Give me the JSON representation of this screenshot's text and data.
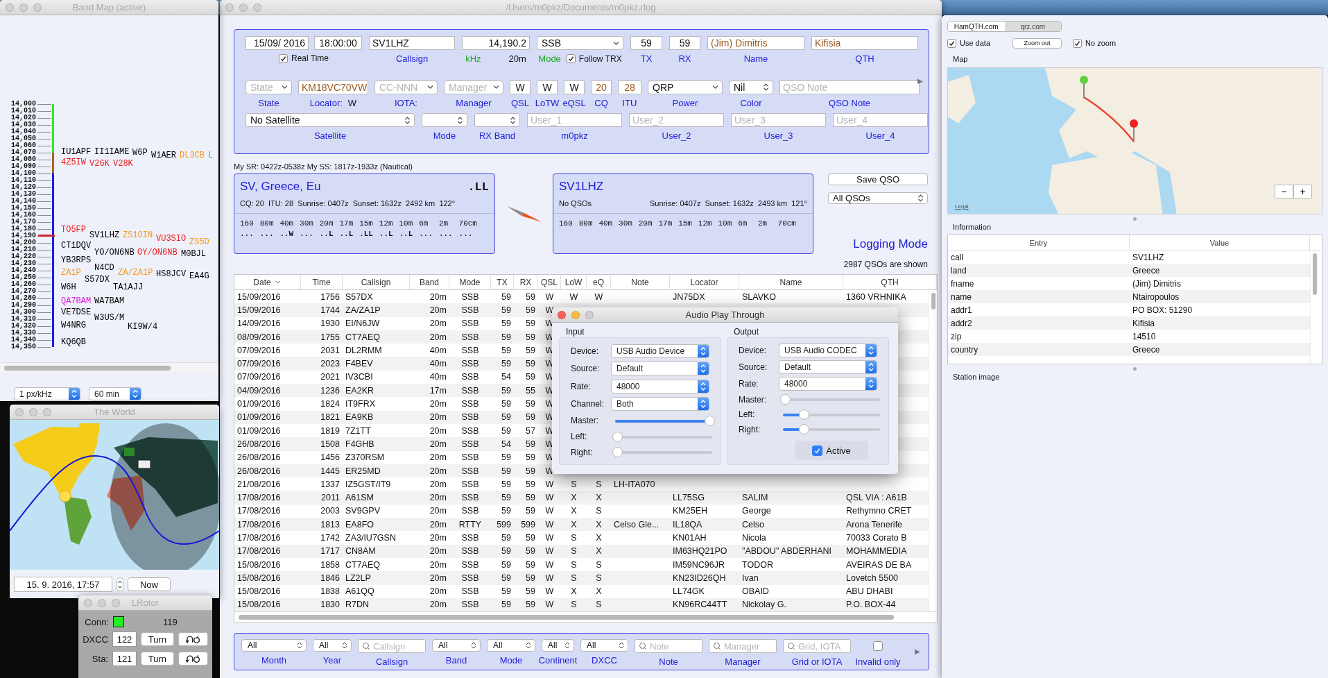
{
  "band_map": {
    "title": "Band Map (active)",
    "scale": [
      "14,000",
      "14,010",
      "14,020",
      "14,030",
      "14,040",
      "14,050",
      "14,060",
      "14,070",
      "14,080",
      "14,090",
      "14,100",
      "14,110",
      "14,120",
      "14,130",
      "14,140",
      "14,150",
      "14,160",
      "14,170",
      "14,180",
      "14,190",
      "14,200",
      "14,210",
      "14,220",
      "14,230",
      "14,240",
      "14,250",
      "14,260",
      "14,270",
      "14,280",
      "14,290",
      "14,300",
      "14,310",
      "14,320",
      "14,330",
      "14,340",
      "14,350"
    ],
    "spots": [
      {
        "call": "IU1APF",
        "color": "#000000"
      },
      {
        "call": "II1IAME",
        "color": "#000000"
      },
      {
        "call": "W6P",
        "color": "#000000"
      },
      {
        "call": "W1AER",
        "color": "#000000"
      },
      {
        "call": "DL3CB",
        "color": "#f39a1e"
      },
      {
        "call": "L",
        "color": "#22cc22"
      },
      {
        "call": "4Z5IW",
        "color": "#ee1c1c"
      },
      {
        "call": "V26K",
        "color": "#ee1c1c"
      },
      {
        "call": "V28K",
        "color": "#ee1c1c"
      },
      {
        "call": "TO5FP",
        "color": "#ee1c1c"
      },
      {
        "call": "SV1LHZ",
        "color": "#000000"
      },
      {
        "call": "ZS1OIN",
        "color": "#f39a1e"
      },
      {
        "call": "VU3SIO",
        "color": "#ee1c1c"
      },
      {
        "call": "ZS5D",
        "color": "#f39a1e"
      },
      {
        "call": "CT1DQV",
        "color": "#000000"
      },
      {
        "call": "YO/ON6NB",
        "color": "#000000"
      },
      {
        "call": "OY/ON6NB",
        "color": "#ee1c1c"
      },
      {
        "call": "M0BJL",
        "color": "#000000"
      },
      {
        "call": "YB3RPS",
        "color": "#000000"
      },
      {
        "call": "N4CD",
        "color": "#000000"
      },
      {
        "call": "ZA1P",
        "color": "#f39a1e"
      },
      {
        "call": "ZA/ZA1P",
        "color": "#f39a1e"
      },
      {
        "call": "HS8JCV",
        "color": "#000000"
      },
      {
        "call": "EA4G",
        "color": "#000000"
      },
      {
        "call": "S57DX",
        "color": "#000000"
      },
      {
        "call": "W6H",
        "color": "#000000"
      },
      {
        "call": "TA1AJJ",
        "color": "#000000"
      },
      {
        "call": "QA7BAM",
        "color": "#e020e0"
      },
      {
        "call": "WA7BAM",
        "color": "#000000"
      },
      {
        "call": "VE7DSE",
        "color": "#000000"
      },
      {
        "call": "W3US/M",
        "color": "#000000"
      },
      {
        "call": "W4NRG",
        "color": "#000000"
      },
      {
        "call": "KI9W/4",
        "color": "#000000"
      },
      {
        "call": "KQ6QB",
        "color": "#000000"
      }
    ],
    "resolution": "1 px/kHz",
    "span": "60 min"
  },
  "world": {
    "title": "The World",
    "datetime": "15. 9. 2016, 17:57",
    "now_button": "Now"
  },
  "rotor": {
    "title": "LRotor",
    "conn_label": "Conn:",
    "connected": true,
    "reading": "119",
    "rows": [
      {
        "label": "DXCC",
        "value": "122",
        "button": "Turn"
      },
      {
        "label": "Sta:",
        "value": "121",
        "button": "Turn"
      }
    ]
  },
  "main": {
    "title": "/Users/m0pkz/Documents/m0pkz.rlog",
    "form": {
      "top_line": [
        {
          "kind": "datetime",
          "date": "15/09/ 2016",
          "time": "18:00:00",
          "check": {
            "label": "Real Time",
            "checked": true
          }
        },
        {
          "kind": "field",
          "value": "SV1LHZ",
          "label": "Callsign"
        },
        {
          "kind": "field",
          "value": "14,190.2",
          "label": "kHz",
          "color": "#1fa81f",
          "band": "20m"
        },
        {
          "kind": "select",
          "value": "SSB",
          "label": "Mode",
          "color": "#1fa81f",
          "check": {
            "label": "Follow TRX",
            "checked": true
          }
        },
        {
          "kind": "field",
          "value": "59",
          "label": "TX"
        },
        {
          "kind": "field",
          "value": "59",
          "label": "RX"
        },
        {
          "kind": "lookup",
          "value": "(Jim) Dimitris",
          "label": "Name"
        },
        {
          "kind": "lookup",
          "value": "Kifisia",
          "label": "QTH"
        }
      ],
      "middle_line": [
        {
          "kind": "select",
          "placeholder": "State",
          "label": "State"
        },
        {
          "kind": "lookup",
          "value": "KM18VC70VW",
          "label": "Locator:",
          "suffix": "W"
        },
        {
          "kind": "select",
          "placeholder": "CC-NNN",
          "label": "IOTA:"
        },
        {
          "kind": "select",
          "placeholder": "Manager",
          "label": "Manager"
        },
        {
          "kind": "field",
          "value": "W",
          "label": "QSL"
        },
        {
          "kind": "field",
          "value": "W",
          "label": "LoTW"
        },
        {
          "kind": "field",
          "value": "W",
          "label": "eQSL"
        },
        {
          "kind": "lookup",
          "value": "20",
          "label": "CQ"
        },
        {
          "kind": "lookup",
          "value": "28",
          "label": "ITU"
        },
        {
          "kind": "select",
          "value": "QRP",
          "label": "Power"
        },
        {
          "kind": "popup",
          "value": "Nil",
          "label": "Color"
        },
        {
          "kind": "field",
          "placeholder": "QSO Note",
          "label": "QSO Note"
        }
      ],
      "bottom_line": [
        {
          "kind": "popup",
          "value": "No Satellite",
          "label": "Satellite"
        },
        {
          "kind": "popup",
          "label": "Mode"
        },
        {
          "kind": "popup",
          "label": "RX Band"
        },
        {
          "kind": "field",
          "placeholder": "User_1",
          "label": "m0pkz"
        },
        {
          "kind": "field",
          "placeholder": "User_2",
          "label": "User_2"
        },
        {
          "kind": "field",
          "placeholder": "User_3",
          "label": "User_3"
        },
        {
          "kind": "field",
          "placeholder": "User_4",
          "label": "User_4"
        }
      ],
      "more": "▶"
    },
    "sun_info": "My SR: 0422z-0538z  My SS: 1817z-1933z (Nautical)",
    "dx_card": {
      "title": "SV, Greece, Eu",
      "marker": ".LL",
      "details": "CQ: 20  ITU: 28  Sunrise: 0407z  Sunset: 1632z  2492 km  122°",
      "bands": [
        {
          "label": "160",
          "status": "..."
        },
        {
          "label": "80m",
          "status": "..."
        },
        {
          "label": "40m",
          "status": "..W"
        },
        {
          "label": "30m",
          "status": "..."
        },
        {
          "label": "20m",
          "status": "..L"
        },
        {
          "label": "17m",
          "status": "..L"
        },
        {
          "label": "15m",
          "status": ".LL"
        },
        {
          "label": "12m",
          "status": "..L"
        },
        {
          "label": "10m",
          "status": "..L"
        },
        {
          "label": "6m",
          "status": "..."
        },
        {
          "label": "2m",
          "status": "..."
        },
        {
          "label": "70cm",
          "status": "..."
        }
      ]
    },
    "call_card": {
      "title": "SV1LHZ",
      "status": "No QSOs",
      "details": "Sunrise: 0407z  Sunset: 1632z  2493 km  121°",
      "bands": [
        {
          "label": "160"
        },
        {
          "label": "80m"
        },
        {
          "label": "40m"
        },
        {
          "label": "30m"
        },
        {
          "label": "20m"
        },
        {
          "label": "17m"
        },
        {
          "label": "15m"
        },
        {
          "label": "12m"
        },
        {
          "label": "10m"
        },
        {
          "label": "6m"
        },
        {
          "label": "2m"
        },
        {
          "label": "70cm"
        }
      ]
    },
    "save_button": "Save QSO",
    "filter_select": "All QSOs",
    "mode_label": "Logging Mode",
    "count": "2987 QSOs are shown",
    "table": {
      "columns": [
        {
          "label": "Date",
          "sorted": true
        },
        {
          "label": "Time",
          "sorted": false
        },
        {
          "label": "Callsign",
          "sorted": false
        },
        {
          "label": "Band",
          "sorted": false
        },
        {
          "label": "Mode",
          "sorted": false
        },
        {
          "label": "TX",
          "sorted": false
        },
        {
          "label": "RX",
          "sorted": false
        },
        {
          "label": "QSL",
          "sorted": false
        },
        {
          "label": "LoW",
          "sorted": false
        },
        {
          "label": "eQ",
          "sorted": false
        },
        {
          "label": "Note",
          "sorted": false
        },
        {
          "label": "Locator",
          "sorted": false
        },
        {
          "label": "Name",
          "sorted": false
        },
        {
          "label": "QTH",
          "sorted": false
        }
      ],
      "rows": [
        {
          "date": "15/09/2016",
          "time": "1756",
          "callsign": "S57DX",
          "band": "20m",
          "mode": "SSB",
          "tx": "59",
          "rx": "59",
          "qsl": "W",
          "low": "W",
          "eq": "W",
          "locator": "JN75DX",
          "name": "SLAVKO",
          "qth": "1360 VRHNIKA"
        },
        {
          "date": "15/09/2016",
          "time": "1744",
          "callsign": "ZA/ZA1P",
          "band": "20m",
          "mode": "SSB",
          "tx": "59",
          "rx": "59",
          "qsl": "W"
        },
        {
          "date": "14/09/2016",
          "time": "1930",
          "callsign": "EI/N6JW",
          "band": "20m",
          "mode": "SSB",
          "tx": "59",
          "rx": "59",
          "qsl": "W"
        },
        {
          "date": "08/09/2016",
          "time": "1755",
          "callsign": "CT7AEQ",
          "band": "20m",
          "mode": "SSB",
          "tx": "59",
          "rx": "59",
          "qsl": "W"
        },
        {
          "date": "07/09/2016",
          "time": "2031",
          "callsign": "DL2RMM",
          "band": "40m",
          "mode": "SSB",
          "tx": "59",
          "rx": "59",
          "qsl": "W"
        },
        {
          "date": "07/09/2016",
          "time": "2023",
          "callsign": "F4BEV",
          "band": "40m",
          "mode": "SSB",
          "tx": "59",
          "rx": "59",
          "qsl": "W"
        },
        {
          "date": "07/09/2016",
          "time": "2021",
          "callsign": "IV3CBI",
          "band": "40m",
          "mode": "SSB",
          "tx": "54",
          "rx": "59",
          "qsl": "W"
        },
        {
          "date": "04/09/2016",
          "time": "1236",
          "callsign": "EA2KR",
          "band": "17m",
          "mode": "SSB",
          "tx": "59",
          "rx": "55",
          "qsl": "W"
        },
        {
          "date": "01/09/2016",
          "time": "1824",
          "callsign": "IT9FRX",
          "band": "20m",
          "mode": "SSB",
          "tx": "59",
          "rx": "59",
          "qsl": "W"
        },
        {
          "date": "01/09/2016",
          "time": "1821",
          "callsign": "EA9KB",
          "band": "20m",
          "mode": "SSB",
          "tx": "59",
          "rx": "59",
          "qsl": "W"
        },
        {
          "date": "01/09/2016",
          "time": "1819",
          "callsign": "7Z1TT",
          "band": "20m",
          "mode": "SSB",
          "tx": "59",
          "rx": "57",
          "qsl": "W"
        },
        {
          "date": "26/08/2016",
          "time": "1508",
          "callsign": "F4GHB",
          "band": "20m",
          "mode": "SSB",
          "tx": "54",
          "rx": "59",
          "qsl": "W"
        },
        {
          "date": "26/08/2016",
          "time": "1456",
          "callsign": "Z370RSM",
          "band": "20m",
          "mode": "SSB",
          "tx": "59",
          "rx": "59",
          "qsl": "W"
        },
        {
          "date": "26/08/2016",
          "time": "1445",
          "callsign": "ER25MD",
          "band": "20m",
          "mode": "SSB",
          "tx": "59",
          "rx": "59",
          "qsl": "W"
        },
        {
          "date": "21/08/2016",
          "time": "1337",
          "callsign": "IZ5GST/IT9",
          "band": "20m",
          "mode": "SSB",
          "tx": "59",
          "rx": "59",
          "qsl": "W",
          "low": "S",
          "eq": "S",
          "note": "LH-ITA070"
        },
        {
          "date": "17/08/2016",
          "time": "2011",
          "callsign": "A61SM",
          "band": "20m",
          "mode": "SSB",
          "tx": "59",
          "rx": "59",
          "qsl": "W",
          "low": "X",
          "eq": "X",
          "locator": "LL75SG",
          "name": "SALIM",
          "qth": "QSL VIA : A61B"
        },
        {
          "date": "17/08/2016",
          "time": "2003",
          "callsign": "SV9GPV",
          "band": "20m",
          "mode": "SSB",
          "tx": "59",
          "rx": "59",
          "qsl": "W",
          "low": "X",
          "eq": "S",
          "locator": "KM25EH",
          "name": "George",
          "qth": "Rethymno CRET"
        },
        {
          "date": "17/08/2016",
          "time": "1813",
          "callsign": "EA8FO",
          "band": "20m",
          "mode": "RTTY",
          "tx": "599",
          "rx": "599",
          "qsl": "W",
          "low": "X",
          "eq": "X",
          "note": "Celso Gle...",
          "locator": "IL18QA",
          "name": "Celso",
          "qth": "Arona Tenerife"
        },
        {
          "date": "17/08/2016",
          "time": "1742",
          "callsign": "ZA3/IU7GSN",
          "band": "20m",
          "mode": "SSB",
          "tx": "59",
          "rx": "59",
          "qsl": "W",
          "low": "S",
          "eq": "X",
          "locator": "KN01AH",
          "name": "Nicola",
          "qth": "70033 Corato B"
        },
        {
          "date": "17/08/2016",
          "time": "1717",
          "callsign": "CN8AM",
          "band": "20m",
          "mode": "SSB",
          "tx": "59",
          "rx": "59",
          "qsl": "W",
          "low": "S",
          "eq": "X",
          "locator": "IM63HQ21PO",
          "name": "\"ABDOU\" ABDERHANI",
          "qth": "MOHAMMEDIA"
        },
        {
          "date": "15/08/2016",
          "time": "1858",
          "callsign": "CT7AEQ",
          "band": "20m",
          "mode": "SSB",
          "tx": "59",
          "rx": "59",
          "qsl": "W",
          "low": "S",
          "eq": "S",
          "locator": "IM59NC96JR",
          "name": "TODOR",
          "qth": "AVEIRAS DE BA"
        },
        {
          "date": "15/08/2016",
          "time": "1846",
          "callsign": "LZ2LP",
          "band": "20m",
          "mode": "SSB",
          "tx": "59",
          "rx": "59",
          "qsl": "W",
          "low": "S",
          "eq": "S",
          "locator": "KN23ID26QH",
          "name": "Ivan",
          "qth": "Lovetch 5500"
        },
        {
          "date": "15/08/2016",
          "time": "1838",
          "callsign": "A61QQ",
          "band": "20m",
          "mode": "SSB",
          "tx": "59",
          "rx": "59",
          "qsl": "W",
          "low": "X",
          "eq": "X",
          "locator": "LL74GK",
          "name": "OBAID",
          "qth": "ABU DHABI"
        },
        {
          "date": "15/08/2016",
          "time": "1830",
          "callsign": "R7DN",
          "band": "20m",
          "mode": "SSB",
          "tx": "59",
          "rx": "59",
          "qsl": "W",
          "low": "S",
          "eq": "S",
          "locator": "KN96RC44TT",
          "name": "Nickolay G.",
          "qth": "P.O. BOX-44"
        }
      ]
    },
    "filters": {
      "items": [
        {
          "kind": "select",
          "value": "All",
          "label": "Month"
        },
        {
          "kind": "select",
          "value": "All",
          "label": "Year"
        },
        {
          "kind": "search",
          "placeholder": "Callsign",
          "label": "Callsign"
        },
        {
          "kind": "select",
          "value": "All",
          "label": "Band"
        },
        {
          "kind": "select",
          "value": "All",
          "label": "Mode"
        },
        {
          "kind": "select",
          "value": "All",
          "label": "Continent"
        },
        {
          "kind": "select",
          "value": "All",
          "label": "DXCC"
        },
        {
          "kind": "search",
          "placeholder": "Note",
          "label": "Note"
        },
        {
          "kind": "search",
          "placeholder": "Manager",
          "label": "Manager"
        },
        {
          "kind": "search",
          "placeholder": "Grid, IOTA",
          "label": "Grid or IOTA"
        },
        {
          "kind": "check",
          "checked": false,
          "label": "Invalid only"
        }
      ],
      "more": "▶"
    }
  },
  "audio_dialog": {
    "title": "Audio Play Through",
    "sections": [
      {
        "title": "Input",
        "selects": [
          {
            "label": "Device:",
            "value": "USB Audio Device"
          },
          {
            "label": "Source:",
            "value": "Default"
          },
          {
            "label": "Rate:",
            "value": "48000"
          },
          {
            "label": "Channel:",
            "value": "Both"
          }
        ],
        "sliders": [
          {
            "label": "Master:",
            "level": 1
          },
          {
            "label": "Left:",
            "level": 0
          },
          {
            "label": "Right:",
            "level": 0
          }
        ]
      },
      {
        "title": "Output",
        "selects": [
          {
            "label": "Device:",
            "value": "USB Audio CODEC"
          },
          {
            "label": "Source:",
            "value": "Default"
          },
          {
            "label": "Rate:",
            "value": "48000"
          }
        ],
        "sliders": [
          {
            "label": "Master:",
            "level": 0
          },
          {
            "label": "Left:",
            "level": 0.2
          },
          {
            "label": "Right:",
            "level": 0.2
          }
        ],
        "active": {
          "label": "Active",
          "checked": true
        }
      }
    ]
  },
  "lookup": {
    "tabs": [
      {
        "label": "HamQTH.com",
        "selected": true
      },
      {
        "label": "qrz.com",
        "selected": false
      }
    ],
    "options": [
      {
        "kind": "check",
        "label": "Use data",
        "checked": true
      },
      {
        "kind": "button",
        "label": "Zoom out"
      },
      {
        "kind": "check",
        "label": "No zoom",
        "checked": true
      }
    ],
    "map_title": "Map",
    "map_legal": "Legal",
    "zoom_controls": [
      "−",
      "+"
    ],
    "info_title": "Information",
    "info_columns": [
      "Entry",
      "Value"
    ],
    "info_rows": [
      {
        "entry": "call",
        "value": "SV1LHZ"
      },
      {
        "entry": "land",
        "value": "Greece"
      },
      {
        "entry": "fname",
        "value": "(Jim) Dimitris"
      },
      {
        "entry": "name",
        "value": "Ntairopoulos"
      },
      {
        "entry": "addr1",
        "value": "PO BOX: 51290"
      },
      {
        "entry": "addr2",
        "value": "Kifisia"
      },
      {
        "entry": "zip",
        "value": "14510"
      },
      {
        "entry": "country",
        "value": "Greece"
      }
    ],
    "image_title": "Station image"
  }
}
